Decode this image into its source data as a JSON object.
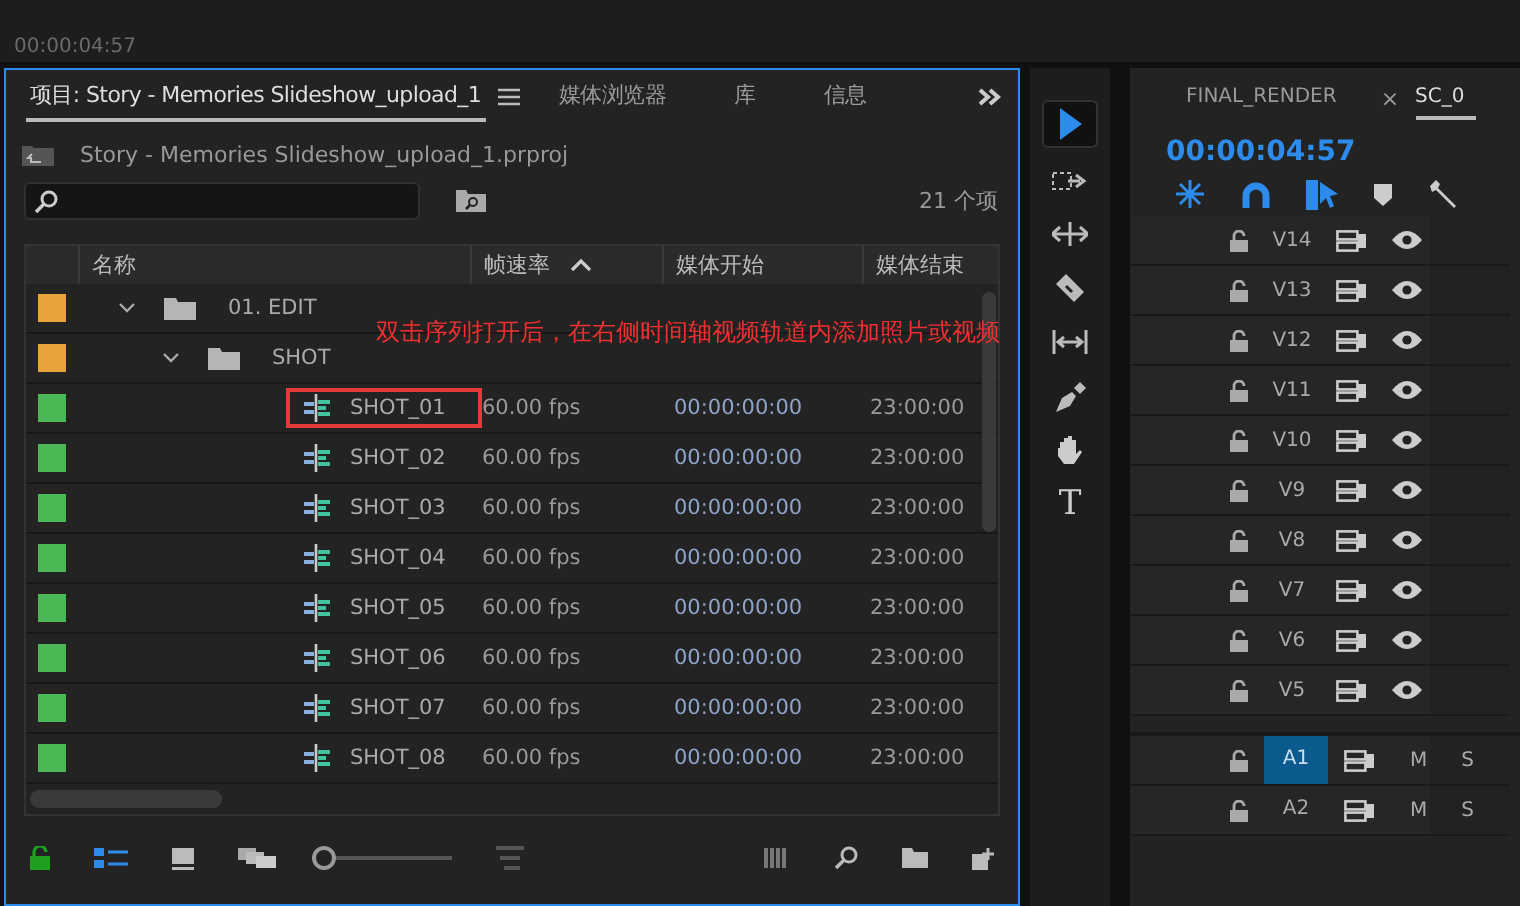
{
  "monitor": {
    "timecode": "00:00:04:57"
  },
  "project": {
    "tabs": [
      {
        "label": "项目: Story - Memories Slideshow_upload_1",
        "selected": true
      },
      {
        "label": "媒体浏览器",
        "selected": false
      },
      {
        "label": "库",
        "selected": false
      },
      {
        "label": "信息",
        "selected": false
      }
    ],
    "bin_path": "Story - Memories Slideshow_upload_1.prproj",
    "item_count": "21 个项",
    "columns": [
      {
        "label": "名称",
        "sorted": false
      },
      {
        "label": "帧速率",
        "sorted": true
      },
      {
        "label": "媒体开始",
        "sorted": false
      },
      {
        "label": "媒体结束",
        "sorted": false
      }
    ],
    "zoom_slider": {
      "level": 0
    },
    "rows": [
      {
        "kind": "folder",
        "name": "01. EDIT",
        "color": "#e8a33a",
        "expanded": true,
        "children": [
          {
            "kind": "folder",
            "name": "SHOT",
            "color": "#e8a33a",
            "expanded": true,
            "children": [
              {
                "kind": "sequence",
                "name": "SHOT_01",
                "color": "#4cb855",
                "frame_rate": "60.00 fps",
                "media_start": "00:00:00:00",
                "media_end": "23:00:00",
                "highlighted": true
              },
              {
                "kind": "sequence",
                "name": "SHOT_02",
                "color": "#4cb855",
                "frame_rate": "60.00 fps",
                "media_start": "00:00:00:00",
                "media_end": "23:00:00",
                "highlighted": false
              },
              {
                "kind": "sequence",
                "name": "SHOT_03",
                "color": "#4cb855",
                "frame_rate": "60.00 fps",
                "media_start": "00:00:00:00",
                "media_end": "23:00:00",
                "highlighted": false
              },
              {
                "kind": "sequence",
                "name": "SHOT_04",
                "color": "#4cb855",
                "frame_rate": "60.00 fps",
                "media_start": "00:00:00:00",
                "media_end": "23:00:00",
                "highlighted": false
              },
              {
                "kind": "sequence",
                "name": "SHOT_05",
                "color": "#4cb855",
                "frame_rate": "60.00 fps",
                "media_start": "00:00:00:00",
                "media_end": "23:00:00",
                "highlighted": false
              },
              {
                "kind": "sequence",
                "name": "SHOT_06",
                "color": "#4cb855",
                "frame_rate": "60.00 fps",
                "media_start": "00:00:00:00",
                "media_end": "23:00:00",
                "highlighted": false
              },
              {
                "kind": "sequence",
                "name": "SHOT_07",
                "color": "#4cb855",
                "frame_rate": "60.00 fps",
                "media_start": "00:00:00:00",
                "media_end": "23:00:00",
                "highlighted": false
              },
              {
                "kind": "sequence",
                "name": "SHOT_08",
                "color": "#4cb855",
                "frame_rate": "60.00 fps",
                "media_start": "00:00:00:00",
                "media_end": "23:00:00",
                "highlighted": false
              }
            ]
          }
        ]
      }
    ],
    "annotation": "双击序列打开后，在右侧时间轴视频轨道内添加照片或视频"
  },
  "tools": [
    {
      "kind": "selection",
      "selected": true
    },
    {
      "kind": "track-select",
      "selected": false
    },
    {
      "kind": "ripple",
      "selected": false
    },
    {
      "kind": "razor",
      "selected": false
    },
    {
      "kind": "slip",
      "selected": false
    },
    {
      "kind": "pen",
      "selected": false
    },
    {
      "kind": "hand",
      "selected": false
    },
    {
      "kind": "type",
      "selected": false,
      "glyph": "T"
    }
  ],
  "timeline": {
    "tabs": [
      {
        "label": "FINAL_RENDER",
        "selected": false
      },
      {
        "label": "SC_0",
        "selected": true,
        "close": "×"
      }
    ],
    "timecode": "00:00:04:57",
    "video_tracks": [
      {
        "label": "V14"
      },
      {
        "label": "V13"
      },
      {
        "label": "V12"
      },
      {
        "label": "V11"
      },
      {
        "label": "V10"
      },
      {
        "label": "V9"
      },
      {
        "label": "V8"
      },
      {
        "label": "V7"
      },
      {
        "label": "V6"
      },
      {
        "label": "V5"
      }
    ],
    "audio_tracks": [
      {
        "label": "A1",
        "selected": true,
        "mute": "M",
        "solo": "S"
      },
      {
        "label": "A2",
        "selected": false,
        "mute": "M",
        "solo": "S"
      }
    ]
  }
}
